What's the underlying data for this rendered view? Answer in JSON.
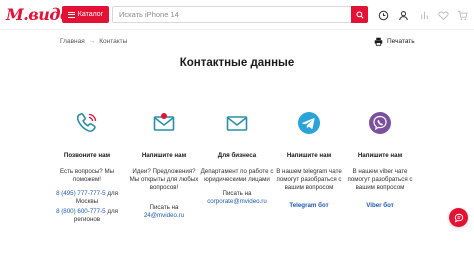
{
  "header": {
    "logo_text": "М.видео",
    "catalog_label": "Каталог",
    "search_placeholder": "Искать iPhone 14",
    "icons": [
      "search-icon",
      "orders-icon",
      "user-icon",
      "compare-icon",
      "favorites-icon",
      "cart-icon"
    ]
  },
  "breadcrumb": {
    "home": "Главная",
    "separator": "→",
    "current": "Контакты"
  },
  "print_label": "Печатать",
  "page_title": "Контактные данные",
  "columns": [
    {
      "icon": "phone-icon",
      "heading": "Позвоните нам",
      "desc": "Есть вопросы? Мы поможем!",
      "phone_1": "8 (495) 777-777-5",
      "phone_1_suffix": " для Москвы",
      "phone_2": "8 (800) 600-777-5",
      "phone_2_suffix": " для регионов"
    },
    {
      "icon": "mail-icon",
      "heading": "Напишите нам",
      "desc": "Идеи? Предложения? Мы открыты для любых вопросов!",
      "write_prefix": "Писать на",
      "email": "24@mvideo.ru"
    },
    {
      "icon": "mail-icon",
      "heading": "Для бизнеса",
      "desc": "Департамент по работе с юридическими лицами",
      "write_prefix": "Писать на",
      "email": "corporate@mvideo.ru"
    },
    {
      "icon": "telegram-icon",
      "heading": "Напишите нам",
      "desc": "В нашем telegram чате помогут разобраться с вашим вопросом",
      "bot_label": "Telegram бот"
    },
    {
      "icon": "viber-icon",
      "heading": "Напишите нам",
      "desc": "В нашем viber чате помогут разобраться с вашим вопросом",
      "bot_label": "Viber бот"
    }
  ],
  "colors": {
    "brand": "#e31235",
    "link": "#1e5cb3",
    "icon_teal": "#2a8fa5",
    "telegram": "#2aa3d8",
    "viber": "#7b519d"
  }
}
